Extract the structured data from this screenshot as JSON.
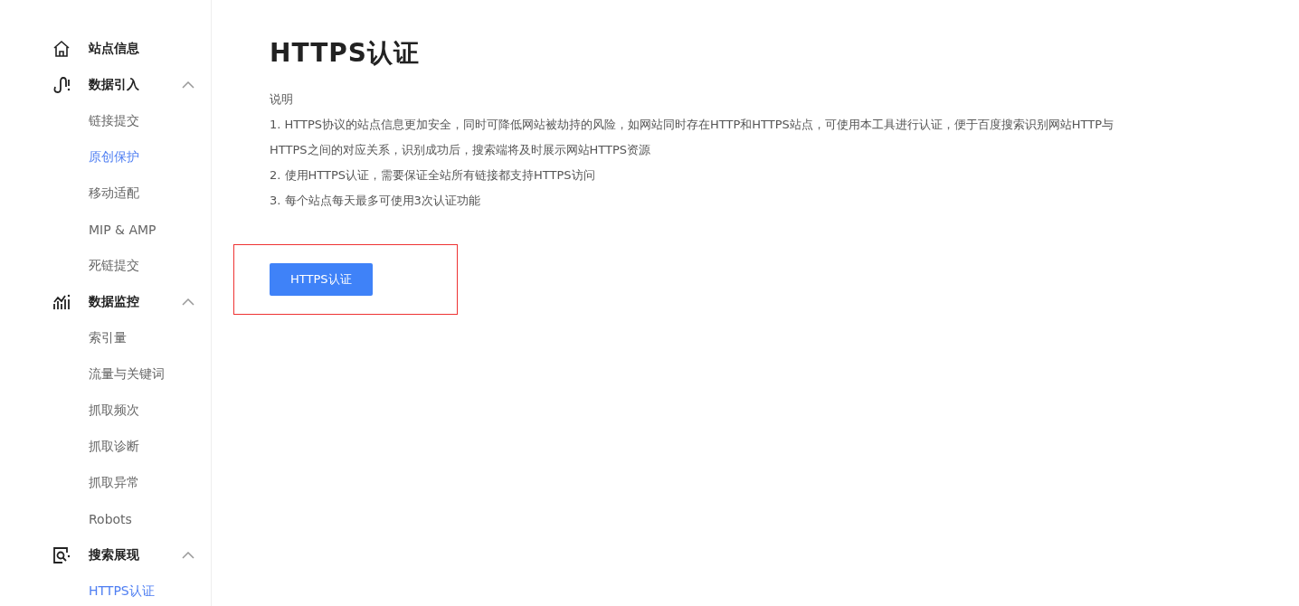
{
  "sidebar": {
    "groups": [
      {
        "label": "站点信息"
      },
      {
        "label": "数据引入",
        "expanded": true,
        "children": [
          {
            "label": "链接提交",
            "selected": false
          },
          {
            "label": "原创保护",
            "selected": true
          },
          {
            "label": "移动适配",
            "selected": false
          },
          {
            "label": "MIP & AMP",
            "selected": false
          },
          {
            "label": "死链提交",
            "selected": false
          }
        ]
      },
      {
        "label": "数据监控",
        "expanded": true,
        "children": [
          {
            "label": "索引量",
            "selected": false
          },
          {
            "label": "流量与关键词",
            "selected": false
          },
          {
            "label": "抓取频次",
            "selected": false
          },
          {
            "label": "抓取诊断",
            "selected": false
          },
          {
            "label": "抓取异常",
            "selected": false
          },
          {
            "label": "Robots",
            "selected": false
          }
        ]
      },
      {
        "label": "搜索展现",
        "expanded": true,
        "children": [
          {
            "label": "HTTPS认证",
            "selected": true
          }
        ]
      }
    ]
  },
  "page": {
    "title": "HTTPS认证",
    "note_heading": "说明",
    "notes": [
      "1. HTTPS协议的站点信息更加安全，同时可降低网站被劫持的风险，如网站同时存在HTTP和HTTPS站点，可使用本工具进行认证，便于百度搜索识别网站HTTP与HTTPS之间的对应关系，识别成功后，搜索端将及时展示网站HTTPS资源",
      "2. 使用HTTPS认证，需要保证全站所有链接都支持HTTPS访问",
      "3. 每个站点每天最多可使用3次认证功能"
    ],
    "button": "HTTPS认证"
  }
}
